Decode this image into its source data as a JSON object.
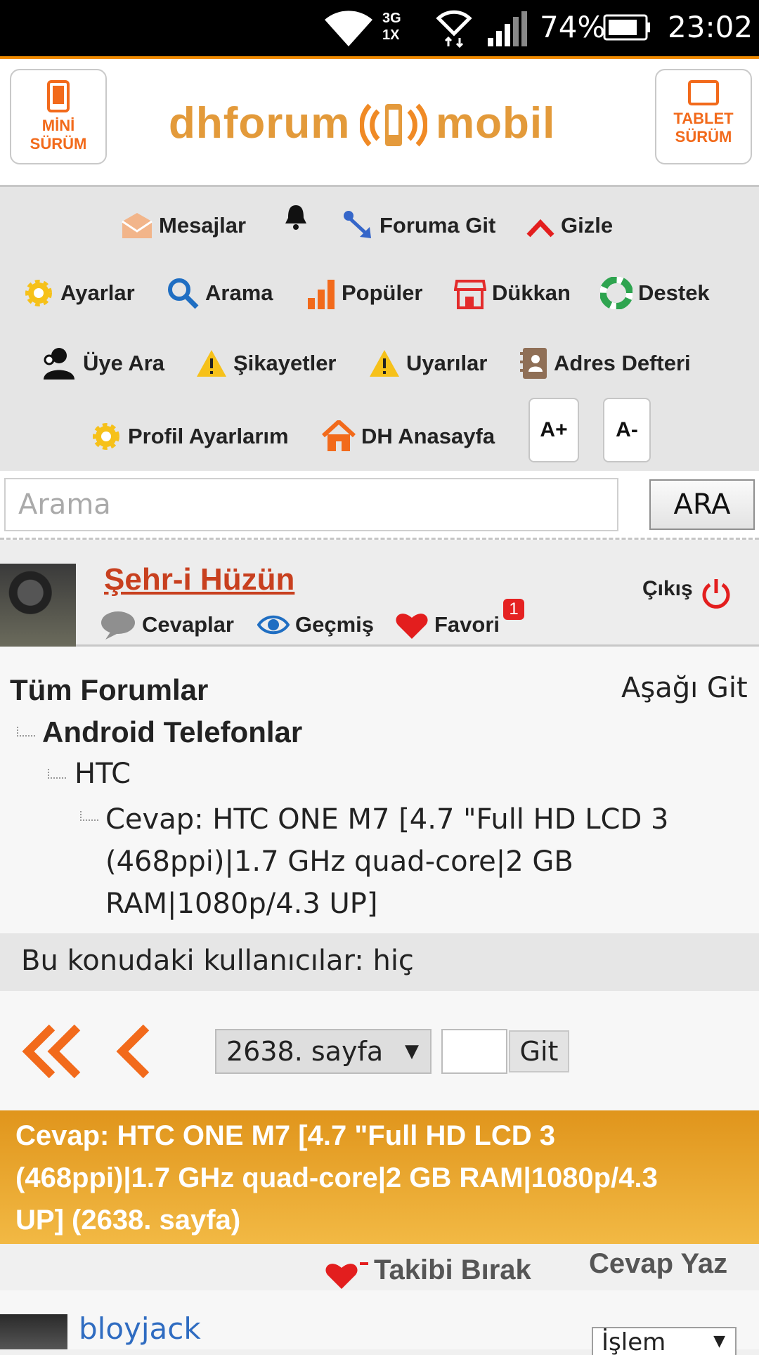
{
  "status_bar": {
    "network_label": "3G 1X",
    "battery_percent": "74%",
    "time": "23:02"
  },
  "header": {
    "mini_label_line1": "MİNİ",
    "mini_label_line2": "SÜRÜM",
    "tablet_label_line1": "TABLET",
    "tablet_label_line2": "SÜRÜM",
    "logo_text_left": "dhforum",
    "logo_text_right": "mobil"
  },
  "nav": {
    "messages": "Mesajlar",
    "goto_forum": "Foruma Git",
    "hide": "Gizle",
    "settings": "Ayarlar",
    "search": "Arama",
    "popular": "Popüler",
    "shop": "Dükkan",
    "support": "Destek",
    "member_search": "Üye Ara",
    "complaints": "Şikayetler",
    "warnings": "Uyarılar",
    "address_book": "Adres Defteri",
    "profile_settings": "Profil Ayarlarım",
    "dh_home": "DH Anasayfa",
    "font_increase": "A+",
    "font_decrease": "A-"
  },
  "search": {
    "placeholder": "Arama",
    "button_label": "ARA"
  },
  "user": {
    "name": "Şehr-i Hüzün",
    "replies": "Cevaplar",
    "history": "Geçmiş",
    "favorites": "Favori",
    "favorites_badge": "1",
    "logout": "Çıkış"
  },
  "breadcrumbs": {
    "root": "Tüm Forumlar",
    "go_down": "Aşağı Git",
    "level1": "Android Telefonlar",
    "level2": "HTC",
    "level3_line1": "Cevap: HTC ONE M7 [4.7 \"Full HD LCD 3",
    "level3_line2": "(468ppi)|1.7 GHz quad-core|2 GB",
    "level3_line3": "RAM|1080p/4.3 UP]"
  },
  "viewers": {
    "text": "Bu konudaki kullanıcılar: hiç"
  },
  "pager": {
    "selected_page": "2638. sayfa",
    "go_label": "Git"
  },
  "thread_title": {
    "line1": "Cevap: HTC ONE M7 [4.7 \"Full HD LCD 3",
    "line2": "(468ppi)|1.7 GHz quad-core|2 GB RAM|1080p/4.3",
    "line3": "UP]  (2638. sayfa)"
  },
  "thread_actions": {
    "unfollow": "Takibi Bırak",
    "reply": "Cevap Yaz"
  },
  "post": {
    "author": "bloyjack",
    "action_select": "İşlem"
  },
  "colors": {
    "accent_orange": "#f26a1b",
    "title_bar": "#e9a52f",
    "username_red": "#c8401f",
    "author_blue": "#2f6cc1"
  }
}
